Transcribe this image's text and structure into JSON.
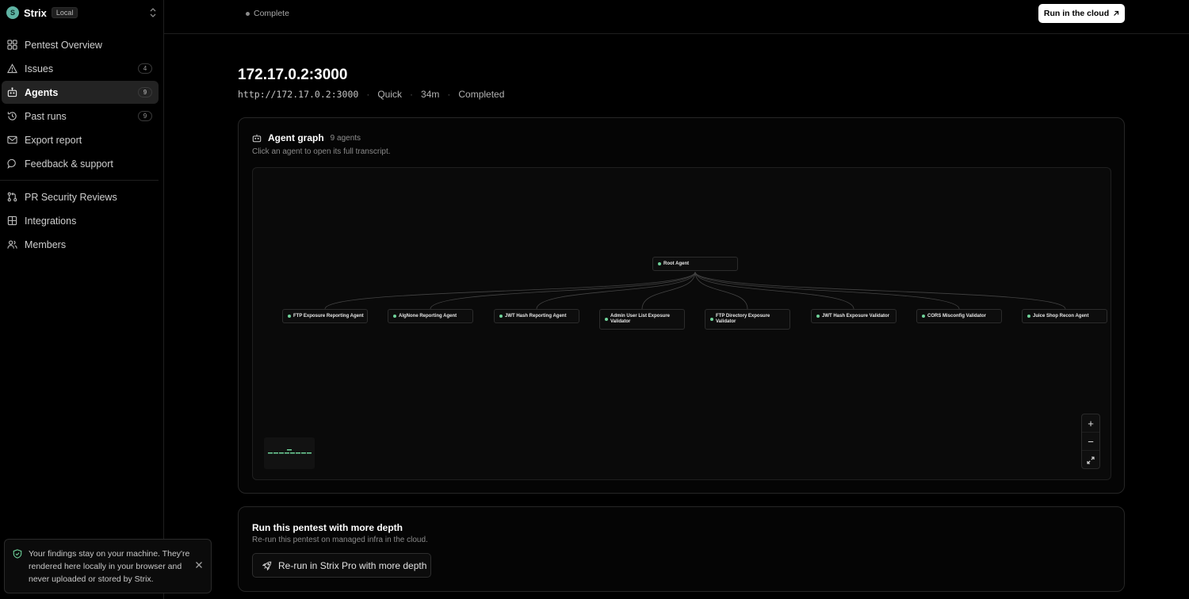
{
  "workspace": {
    "initial": "S",
    "name": "Strix",
    "badge": "Local"
  },
  "sidebar": {
    "items": [
      {
        "label": "Pentest Overview",
        "icon": "grid-icon"
      },
      {
        "label": "Issues",
        "icon": "warning-icon",
        "count": "4"
      },
      {
        "label": "Agents",
        "icon": "robot-icon",
        "count": "9",
        "active": true
      },
      {
        "label": "Past runs",
        "icon": "history-icon",
        "count": "9"
      },
      {
        "label": "Export report",
        "icon": "mail-icon"
      },
      {
        "label": "Feedback & support",
        "icon": "chat-icon"
      }
    ],
    "items2": [
      {
        "label": "PR Security Reviews",
        "icon": "git-pull-request-icon"
      },
      {
        "label": "Integrations",
        "icon": "puzzle-icon"
      },
      {
        "label": "Members",
        "icon": "users-icon"
      }
    ]
  },
  "toast": {
    "text": "Your findings stay on your machine. They're rendered here locally in your browser and never uploaded or stored by Strix."
  },
  "header": {
    "status": "Complete",
    "cloud_button": "Run in the cloud"
  },
  "target": {
    "title": "172.17.0.2:3000",
    "url": "http://172.17.0.2:3000",
    "mode": "Quick",
    "duration": "34m",
    "state": "Completed"
  },
  "graph": {
    "title": "Agent graph",
    "count": "9 agents",
    "subtitle": "Click an agent to open its full transcript.",
    "root": "Root Agent",
    "children": [
      "FTP Exposure Reporting Agent",
      "AlgNone Reporting Agent",
      "JWT Hash Reporting Agent",
      "Admin User List Exposure Validator",
      "FTP Directory Exposure Validator",
      "JWT Hash Exposure Validator",
      "CORS Misconfig Validator",
      "Juice Shop Recon Agent"
    ],
    "zoom_in": "+",
    "zoom_out": "−"
  },
  "depth": {
    "title": "Run this pentest with more depth",
    "subtitle": "Re-run this pentest on managed infra in the cloud.",
    "button": "Re-run in Strix Pro with more depth"
  },
  "colors": {
    "accent": "#5fb3a3",
    "node_dot": "#6fd39a"
  }
}
